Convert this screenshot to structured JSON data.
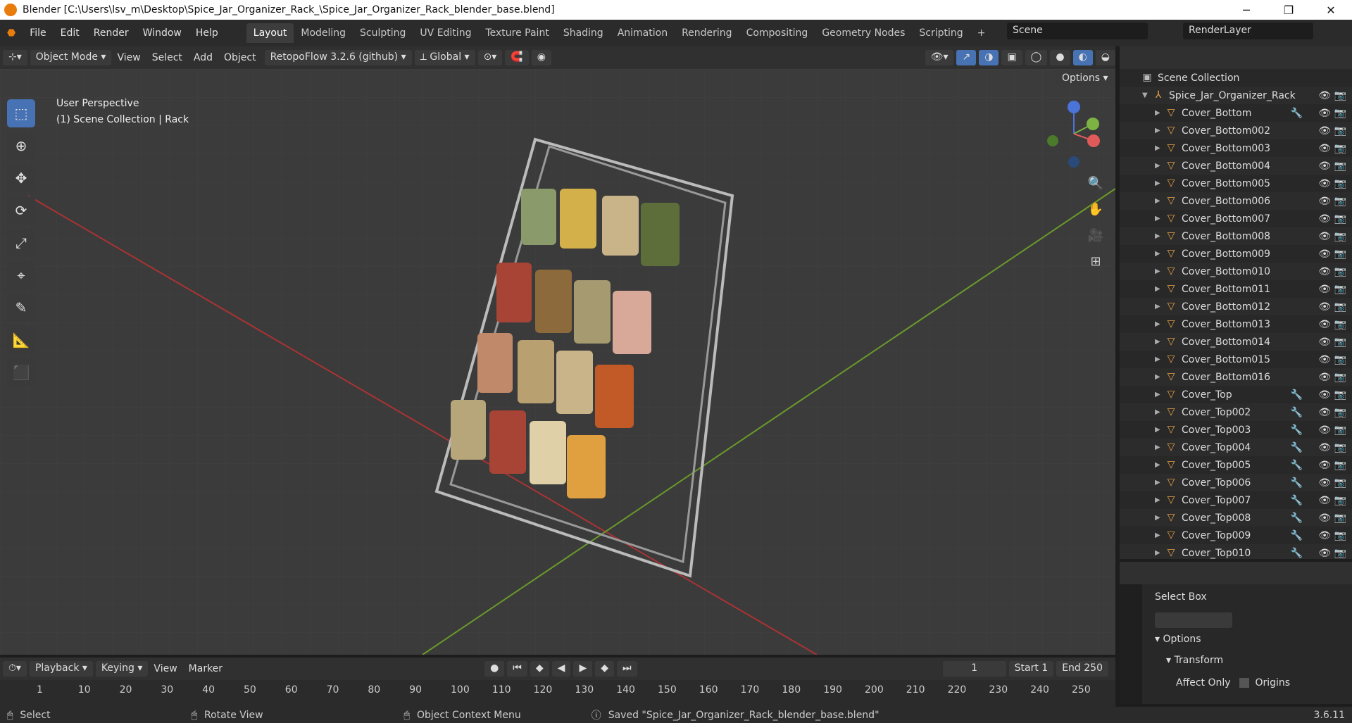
{
  "title": "Blender [C:\\Users\\lsv_m\\Desktop\\Spice_Jar_Organizer_Rack_\\Spice_Jar_Organizer_Rack_blender_base.blend]",
  "menu": [
    "File",
    "Edit",
    "Render",
    "Window",
    "Help"
  ],
  "workspaces": [
    "Layout",
    "Modeling",
    "Sculpting",
    "UV Editing",
    "Texture Paint",
    "Shading",
    "Animation",
    "Rendering",
    "Compositing",
    "Geometry Nodes",
    "Scripting"
  ],
  "active_workspace": "Layout",
  "scene": "Scene",
  "render_layer": "RenderLayer",
  "viewport_header": {
    "mode": "Object Mode",
    "view": "View",
    "select": "Select",
    "add": "Add",
    "object": "Object",
    "addon": "RetopoFlow 3.2.6 (github)",
    "orientation": "Global"
  },
  "options_label": "Options",
  "overlay": {
    "perspective": "User Perspective",
    "collection": "(1) Scene Collection | Rack"
  },
  "gizmo_axes": [
    "Z",
    "Y",
    "X"
  ],
  "outliner": {
    "root": "Scene Collection",
    "collection": "Spice_Jar_Organizer_Rack",
    "items": [
      {
        "name": "Cover_Bottom",
        "modifier": true
      },
      {
        "name": "Cover_Bottom002",
        "modifier": false
      },
      {
        "name": "Cover_Bottom003",
        "modifier": false
      },
      {
        "name": "Cover_Bottom004",
        "modifier": false
      },
      {
        "name": "Cover_Bottom005",
        "modifier": false
      },
      {
        "name": "Cover_Bottom006",
        "modifier": false
      },
      {
        "name": "Cover_Bottom007",
        "modifier": false
      },
      {
        "name": "Cover_Bottom008",
        "modifier": false
      },
      {
        "name": "Cover_Bottom009",
        "modifier": false
      },
      {
        "name": "Cover_Bottom010",
        "modifier": false
      },
      {
        "name": "Cover_Bottom011",
        "modifier": false
      },
      {
        "name": "Cover_Bottom012",
        "modifier": false
      },
      {
        "name": "Cover_Bottom013",
        "modifier": false
      },
      {
        "name": "Cover_Bottom014",
        "modifier": false
      },
      {
        "name": "Cover_Bottom015",
        "modifier": false
      },
      {
        "name": "Cover_Bottom016",
        "modifier": false
      },
      {
        "name": "Cover_Top",
        "modifier": true
      },
      {
        "name": "Cover_Top002",
        "modifier": true
      },
      {
        "name": "Cover_Top003",
        "modifier": true
      },
      {
        "name": "Cover_Top004",
        "modifier": true
      },
      {
        "name": "Cover_Top005",
        "modifier": true
      },
      {
        "name": "Cover_Top006",
        "modifier": true
      },
      {
        "name": "Cover_Top007",
        "modifier": true
      },
      {
        "name": "Cover_Top008",
        "modifier": true
      },
      {
        "name": "Cover_Top009",
        "modifier": true
      },
      {
        "name": "Cover_Top010",
        "modifier": true
      }
    ]
  },
  "properties": {
    "tool": "Select Box",
    "options": "Options",
    "transform": "Transform",
    "affect_only": "Affect Only",
    "origins": "Origins"
  },
  "timeline": {
    "playback": "Playback",
    "keying": "Keying",
    "view": "View",
    "marker": "Marker",
    "current_frame": "1",
    "start_label": "Start",
    "start": "1",
    "end_label": "End",
    "end": "250",
    "ticks": [
      "1",
      "10",
      "20",
      "30",
      "40",
      "50",
      "60",
      "70",
      "80",
      "90",
      "100",
      "110",
      "120",
      "130",
      "140",
      "150",
      "160",
      "170",
      "180",
      "190",
      "200",
      "210",
      "220",
      "230",
      "240",
      "250"
    ]
  },
  "status": {
    "select": "Select",
    "rotate": "Rotate View",
    "context": "Object Context Menu",
    "message": "Saved \"Spice_Jar_Organizer_Rack_blender_base.blend\"",
    "version": "3.6.11"
  }
}
